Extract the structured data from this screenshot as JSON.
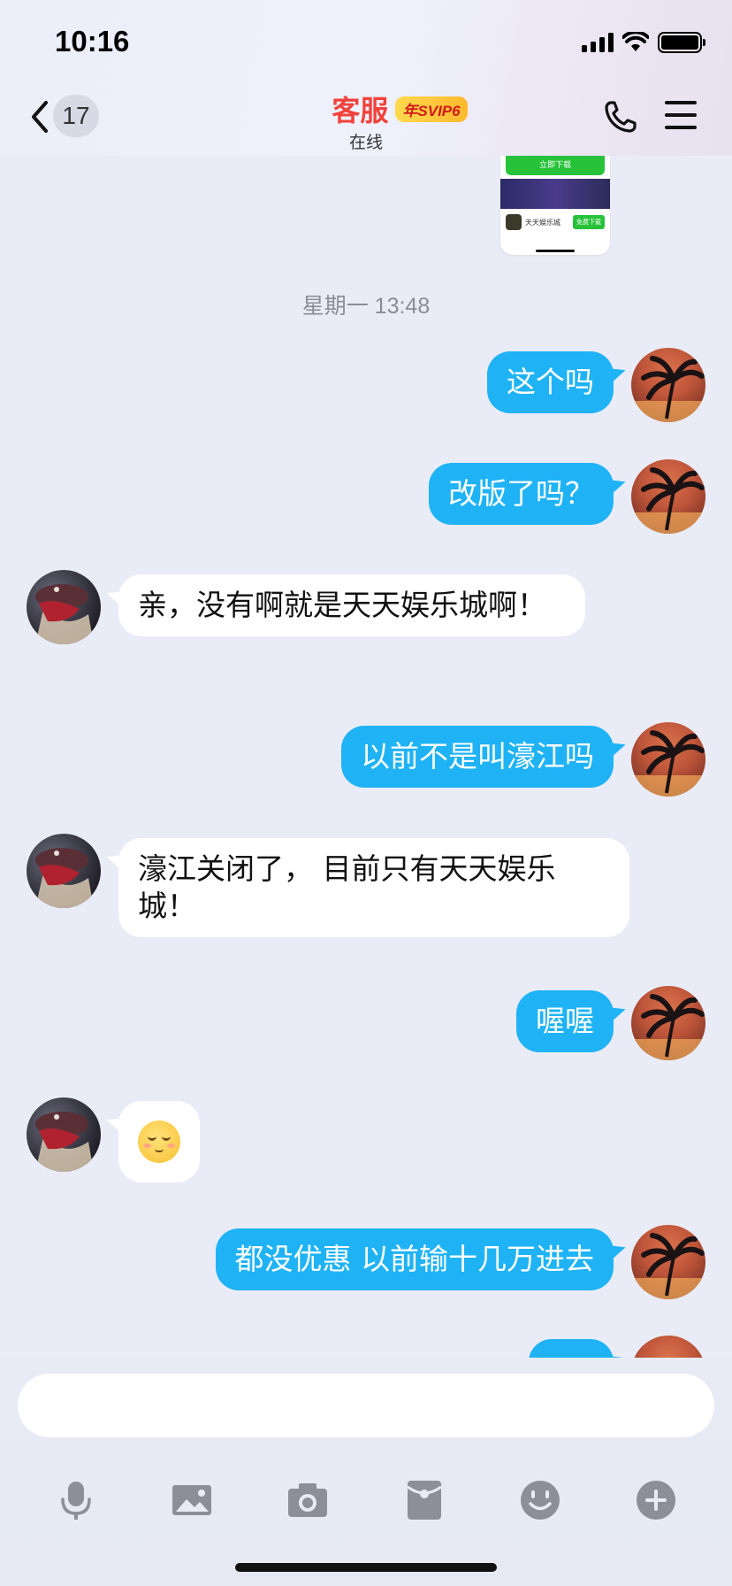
{
  "status_bar": {
    "time": "10:16"
  },
  "header": {
    "back_count": "17",
    "title": "客服",
    "vip_badge": "年SVIP6",
    "status": "在线"
  },
  "chat": {
    "timestamp": "星期一 13:48",
    "thumbnail": {
      "button": "立即下载",
      "app_name": "天天娱乐城",
      "download": "免费下载"
    },
    "messages": [
      {
        "from": "me",
        "text": "这个吗"
      },
      {
        "from": "me",
        "text": "改版了吗？"
      },
      {
        "from": "cs",
        "text": "  亲，没有啊就是天天娱乐城啊！"
      },
      {
        "from": "me",
        "text": "以前不是叫濠江吗"
      },
      {
        "from": "cs",
        "text": " 濠江关闭了，   目前只有天天娱乐城！"
      },
      {
        "from": "me",
        "text": "喔喔"
      },
      {
        "from": "cs",
        "emoji": "relieved-face"
      },
      {
        "from": "me",
        "text": "都没优惠 以前输十几万进去"
      }
    ]
  },
  "composer": {
    "placeholder": "",
    "tools": [
      "mic-icon",
      "image-icon",
      "camera-icon",
      "red-packet-icon",
      "emoji-icon",
      "plus-icon"
    ]
  },
  "colors": {
    "my_bubble": "#1fb3f5",
    "their_bubble": "#ffffff",
    "title": "#f2413b",
    "background": "#e9ecf6"
  }
}
